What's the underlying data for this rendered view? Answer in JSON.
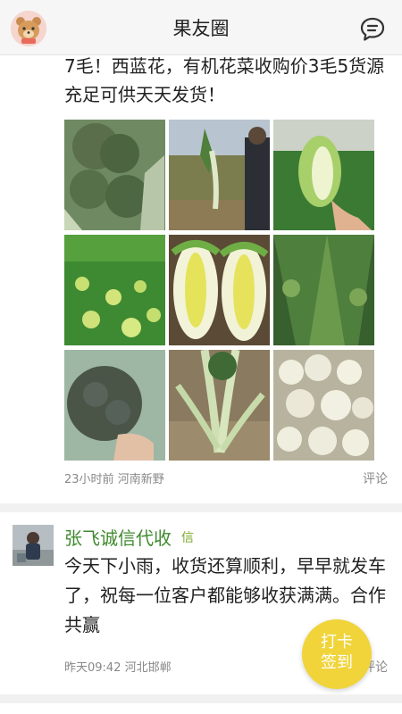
{
  "header": {
    "title": "果友圈",
    "avatar_icon": "bear-avatar-icon",
    "message_icon": "chat-bubble-icon"
  },
  "posts": [
    {
      "text": "7毛！西蓝花，有机花菜收购价3毛5货源充足可供天天发货！",
      "time": "23小时前",
      "location": "河南新野",
      "comment_label": "评论",
      "images": [
        "broccoli-heads-photo",
        "person-holding-kohlrabi-photo",
        "hand-holding-cabbage-photo",
        "cabbage-field-photo",
        "halved-cabbage-photo",
        "cabbage-rows-photo",
        "broccoli-held-photo",
        "kohlrabi-stalks-photo",
        "cauliflower-pile-photo"
      ]
    },
    {
      "author": "张飞诚信代收",
      "badge": "信",
      "text": "今天下小雨，收货还算顺利，早早就发车了，祝每一位客户都能够收获满满。合作共赢",
      "time": "昨天09:42",
      "location": "河北邯郸",
      "comment_label": "评论"
    }
  ],
  "fab": {
    "line1": "打卡",
    "line2": "签到",
    "color": "#f0d43a"
  },
  "colors": {
    "author_green": "#3f8a2e",
    "badge_green": "#7aaa2a",
    "meta_gray": "#888888"
  }
}
